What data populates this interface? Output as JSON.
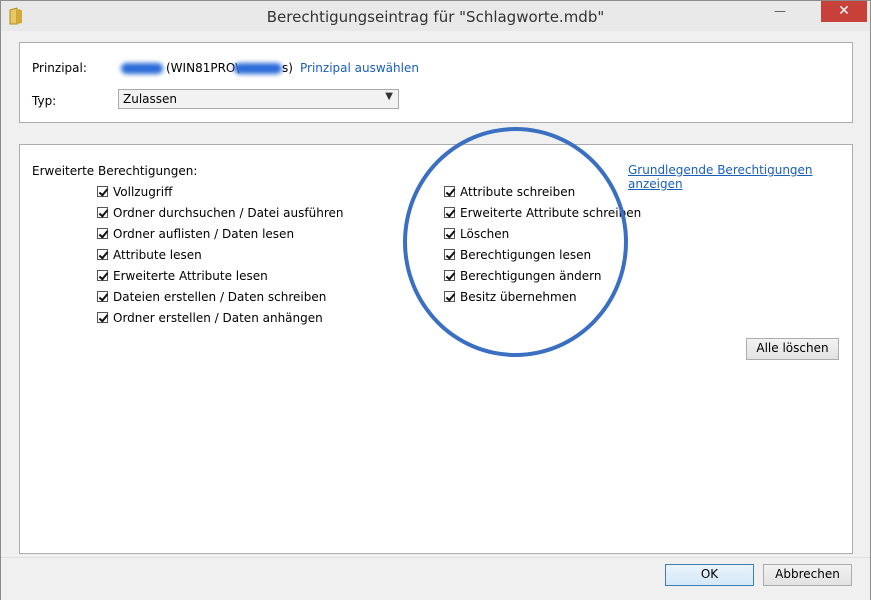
{
  "window": {
    "title": "Berechtigungseintrag für \"Schlagworte.mdb\"",
    "minimize": "—",
    "close": "✕"
  },
  "principal": {
    "label": "Prinzipal:",
    "value": "(WIN81PRO\\",
    "suffix": "s)",
    "link": "Prinzipal auswählen"
  },
  "type": {
    "label": "Typ:",
    "selected": "Zulassen"
  },
  "perms": {
    "heading": "Erweiterte Berechtigungen:",
    "toggle_link": "Grundlegende Berechtigungen anzeigen",
    "left": [
      "Vollzugriff",
      "Ordner durchsuchen / Datei ausführen",
      "Ordner auflisten / Daten lesen",
      "Attribute lesen",
      "Erweiterte Attribute lesen",
      "Dateien erstellen / Daten schreiben",
      "Ordner erstellen / Daten anhängen"
    ],
    "right": [
      "Attribute schreiben",
      "Erweiterte Attribute schreiben",
      "Löschen",
      "Berechtigungen lesen",
      "Berechtigungen ändern",
      "Besitz übernehmen"
    ],
    "clear_all": "Alle löschen"
  },
  "buttons": {
    "ok": "OK",
    "cancel": "Abbrechen"
  },
  "colors": {
    "accent": "#1a5fb8",
    "close": "#c7403a",
    "circle": "#3a6fc2"
  }
}
